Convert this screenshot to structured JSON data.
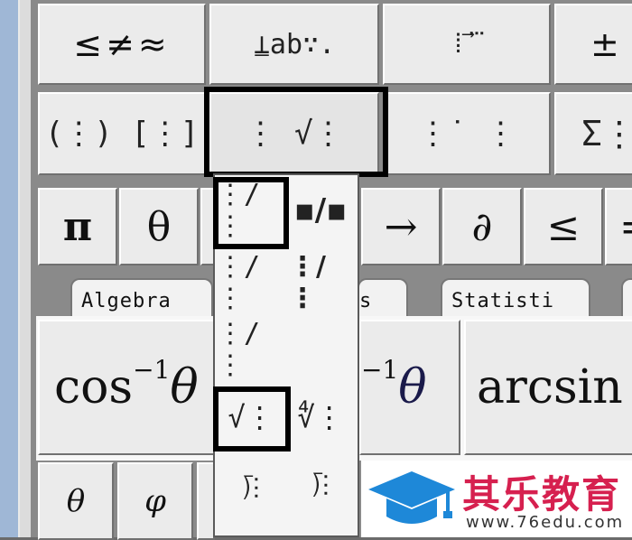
{
  "toolbar_row1": {
    "relations": "≤≠≈",
    "spaces": "⍊ab∵.",
    "embellish": "⁞ ⃗ ⃛",
    "operators": "±"
  },
  "toolbar_row2": {
    "fences": "(⋮) [⋮]",
    "fraction_radical": "⋮ √⋮",
    "scripts": "⋮˙ ⋮",
    "sums": "Σ⋮"
  },
  "toolbar_row3": {
    "pi": "π",
    "theta": "θ",
    "arrow": "→",
    "partial": "∂",
    "le": "≤",
    "more": "="
  },
  "tabs": {
    "algebra": "Algebra",
    "middle": "s",
    "statistics": "Statisti"
  },
  "templates": {
    "acos_base": "cos",
    "acos_sup": "−1",
    "acos_var": "θ",
    "mid_sup": "−1",
    "mid_var": "θ",
    "arcsin": "arcsin"
  },
  "bottom_row": {
    "theta": "θ",
    "phi": "φ"
  },
  "dropdown": {
    "items": {
      "full_fraction": "⋮/⋮",
      "small_fraction": "▪/▪",
      "slash_fraction_lg": "⋮/⋮",
      "slash_fraction_sm": "⋮/⋮",
      "square_root": "√⋮",
      "nth_root": "∜⋮",
      "long_division": "⟌⋮",
      "long_division_quot": "⟌⋮"
    }
  },
  "watermark": {
    "name": "其乐教育",
    "url": "www.76edu.com",
    "brand_color": "#d6204f",
    "cap_color": "#1e88d8"
  }
}
